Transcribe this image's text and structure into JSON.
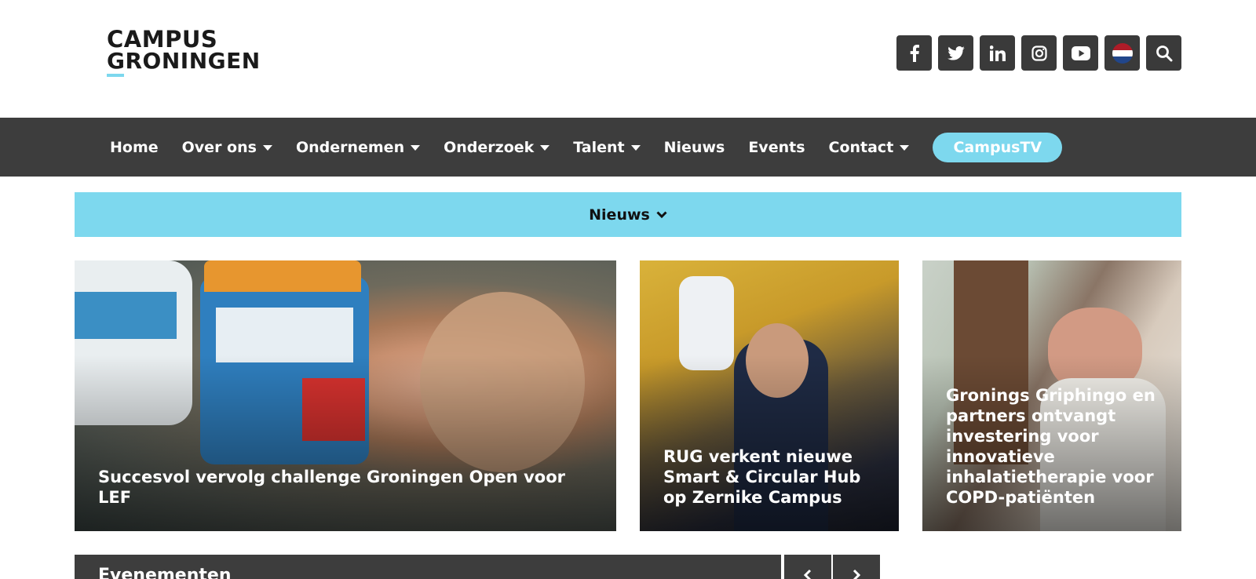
{
  "header": {
    "logo_line1": "CAMPUS",
    "logo_line2": "GRONINGEN",
    "social": [
      {
        "icon": "facebook-icon"
      },
      {
        "icon": "twitter-icon"
      },
      {
        "icon": "linkedin-icon"
      },
      {
        "icon": "instagram-icon"
      },
      {
        "icon": "youtube-icon"
      },
      {
        "icon": "dutch-flag-icon"
      },
      {
        "icon": "search-icon"
      }
    ]
  },
  "nav": {
    "items": [
      {
        "label": "Home",
        "dropdown": false
      },
      {
        "label": "Over ons",
        "dropdown": true
      },
      {
        "label": "Ondernemen",
        "dropdown": true
      },
      {
        "label": "Onderzoek",
        "dropdown": true
      },
      {
        "label": "Talent",
        "dropdown": true
      },
      {
        "label": "Nieuws",
        "dropdown": false
      },
      {
        "label": "Events",
        "dropdown": false
      },
      {
        "label": "Contact",
        "dropdown": true
      }
    ],
    "cta_label": "CampusTV"
  },
  "filter": {
    "label": "Nieuws"
  },
  "cards": [
    {
      "title": "Succesvol vervolg challenge Groningen Open voor LEF"
    },
    {
      "title": "RUG verkent nieuwe Smart & Circular Hub op Zernike Campus"
    },
    {
      "title": "Gronings Griphingo en partners ontvangt investering voor innovatieve inhalatietherapie voor COPD-patiënten"
    }
  ],
  "events": {
    "title": "Evenementen"
  },
  "colors": {
    "accent": "#7dd8ee",
    "dark": "#3d3d3d"
  }
}
